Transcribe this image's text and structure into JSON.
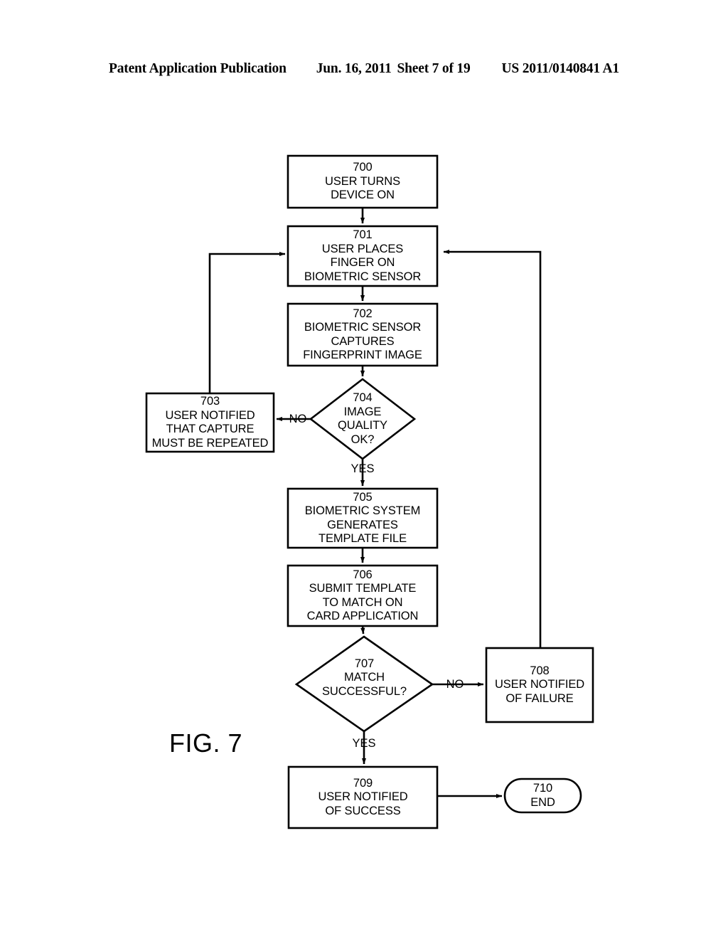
{
  "header": {
    "publication": "Patent Application Publication",
    "date": "Jun. 16, 2011",
    "sheet": "Sheet 7 of 19",
    "document_number": "US 2011/0140841 A1"
  },
  "figure": {
    "caption": "FIG. 7",
    "line_color": "#000000",
    "background": "#ffffff"
  },
  "flowchart": {
    "type": "flowchart",
    "nodes": [
      {
        "id": "700",
        "shape": "process",
        "ref": "700",
        "text": "USER TURNS\nDEVICE ON"
      },
      {
        "id": "701",
        "shape": "process",
        "ref": "701",
        "text": "USER PLACES\nFINGER ON\nBIOMETRIC SENSOR"
      },
      {
        "id": "702",
        "shape": "process",
        "ref": "702",
        "text": "BIOMETRIC SENSOR\nCAPTURES\nFINGERPRINT IMAGE"
      },
      {
        "id": "703",
        "shape": "process",
        "ref": "703",
        "text": "USER NOTIFIED\nTHAT CAPTURE\nMUST BE REPEATED"
      },
      {
        "id": "704",
        "shape": "decision",
        "ref": "704",
        "text": "IMAGE\nQUALITY\nOK?"
      },
      {
        "id": "705",
        "shape": "process",
        "ref": "705",
        "text": "BIOMETRIC SYSTEM\nGENERATES\nTEMPLATE FILE"
      },
      {
        "id": "706",
        "shape": "process",
        "ref": "706",
        "text": "SUBMIT TEMPLATE\nTO MATCH ON\nCARD APPLICATION"
      },
      {
        "id": "707",
        "shape": "decision",
        "ref": "707",
        "text": "MATCH\nSUCCESSFUL?"
      },
      {
        "id": "708",
        "shape": "process",
        "ref": "708",
        "text": "USER NOTIFIED\nOF FAILURE"
      },
      {
        "id": "709",
        "shape": "process",
        "ref": "709",
        "text": "USER NOTIFIED\nOF SUCCESS"
      },
      {
        "id": "710",
        "shape": "terminator",
        "ref": "710",
        "text": "END"
      }
    ],
    "edge_labels": {
      "quality_no": "NO",
      "quality_yes": "YES",
      "match_no": "NO",
      "match_yes": "YES"
    }
  }
}
